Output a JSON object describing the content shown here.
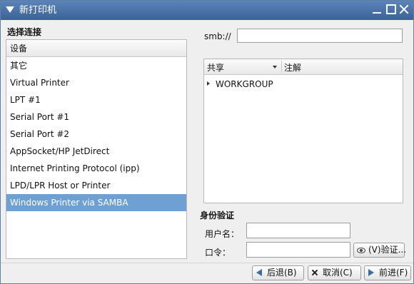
{
  "window": {
    "title": "新打印机"
  },
  "left": {
    "section_title": "选择连接",
    "header": "设备",
    "devices": [
      "其它",
      "Virtual Printer",
      "LPT #1",
      "Serial Port #1",
      "Serial Port #2",
      "AppSocket/HP JetDirect",
      "Internet Printing Protocol (ipp)",
      "LPD/LPR Host or Printer",
      "Windows Printer via SAMBA"
    ],
    "selected_index": 8
  },
  "smb": {
    "label": "smb://",
    "value": ""
  },
  "share_list": {
    "columns": {
      "share": "共享",
      "comment": "注解"
    },
    "workgroup": "WORKGROUP"
  },
  "auth": {
    "section_title": "身份验证",
    "username_label": "用户名：",
    "username_value": "",
    "password_label": "口令：",
    "password_value": "",
    "verify_button": "(V)验证..."
  },
  "actions": {
    "back": "后退(B)",
    "cancel": "取消(C)",
    "forward": "前进(F)"
  },
  "colors": {
    "title_bar": "#4a75ad",
    "selected_row": "#6fa0d4"
  }
}
